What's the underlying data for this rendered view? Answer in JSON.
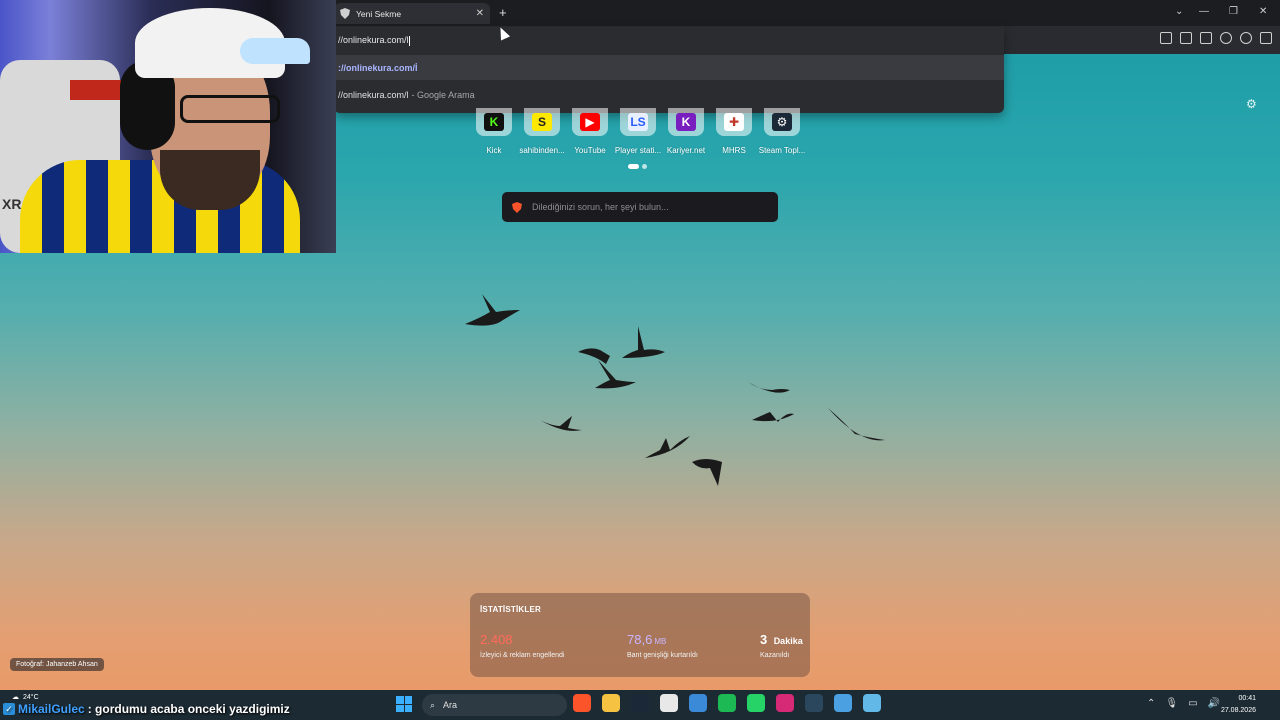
{
  "browser": {
    "tab_title": "Yeni Sekme",
    "tab_close": "✕",
    "new_tab": "+",
    "window_controls": {
      "dropdown": "⌄",
      "minimize": "—",
      "restore": "❐",
      "close": "✕"
    }
  },
  "omnibox": {
    "input_value": "//onlinekura.com/l",
    "suggestions": [
      {
        "text": "://onlinekura.com/İ",
        "suffix": ""
      },
      {
        "text": "//onlinekura.com/l",
        "suffix": "- Google Arama"
      }
    ]
  },
  "webcam": {
    "brand_text": "XR"
  },
  "top_sites": [
    {
      "label": "Kick",
      "logo": "K",
      "bg": "#111111",
      "fg": "#53fc18",
      "icon": "kick-icon"
    },
    {
      "label": "sahibinden...",
      "logo": "S",
      "bg": "#ffe800",
      "fg": "#222222",
      "icon": "sahibinden-icon"
    },
    {
      "label": "YouTube",
      "logo": "▶",
      "bg": "#ff0000",
      "fg": "#ffffff",
      "icon": "youtube-icon"
    },
    {
      "label": "Player stati...",
      "logo": "LS",
      "bg": "#e8f0ff",
      "fg": "#2a5cff",
      "icon": "player-stats-icon"
    },
    {
      "label": "Kariyer.net",
      "logo": "K",
      "bg": "#7a1fbf",
      "fg": "#ffffff",
      "icon": "kariyer-icon"
    },
    {
      "label": "MHRS",
      "logo": "✚",
      "bg": "#ffffff",
      "fg": "#c0392b",
      "icon": "mhrs-icon"
    },
    {
      "label": "Steam Topl...",
      "logo": "⚙",
      "bg": "#1b2838",
      "fg": "#ffffff",
      "icon": "steam-icon"
    }
  ],
  "search": {
    "placeholder": "Dilediğinizi sorun, her şeyi bulun..."
  },
  "stats": {
    "title": "İSTATİSTİKLER",
    "items": [
      {
        "value": "2.408",
        "unit": "",
        "desc": "İzleyici & reklam engellendi"
      },
      {
        "value": "78,6",
        "unit": "MB",
        "desc": "Bant genişliği kurtarıldı"
      },
      {
        "value": "3",
        "unit": "Dakika",
        "desc": "Kazanıldı"
      }
    ]
  },
  "photo_credit": "Fotoğraf: Jahanzeb Ahsan",
  "taskbar": {
    "weather": "24°C",
    "search_label": "Ara",
    "chat_user": "MikailGulec",
    "chat_message": ": gordumu acaba onceki yazdigimiz",
    "time": "00:41",
    "date": "27.08.2026",
    "apps": [
      {
        "name": "brave-icon",
        "color": "#fb542b"
      },
      {
        "name": "file-explorer-icon",
        "color": "#f5c242"
      },
      {
        "name": "steam-icon",
        "color": "#1b2838"
      },
      {
        "name": "chrome-icon",
        "color": "#e8e8e8"
      },
      {
        "name": "settings-app-icon",
        "color": "#3a8ad8"
      },
      {
        "name": "spotify-icon",
        "color": "#1db954"
      },
      {
        "name": "whatsapp-icon",
        "color": "#25d366"
      },
      {
        "name": "instagram-icon",
        "color": "#d62976"
      },
      {
        "name": "steam-alt-icon",
        "color": "#2a475e"
      },
      {
        "name": "photos-icon",
        "color": "#4aa0e0"
      },
      {
        "name": "notepad-icon",
        "color": "#62b8e6"
      }
    ],
    "tray": [
      "⌃",
      "🎙",
      "▭",
      "🔊"
    ]
  },
  "colors": {
    "accent": "#a9b6ff",
    "blocked": "#ff6b5a",
    "bandwidth": "#c9b6ff"
  }
}
